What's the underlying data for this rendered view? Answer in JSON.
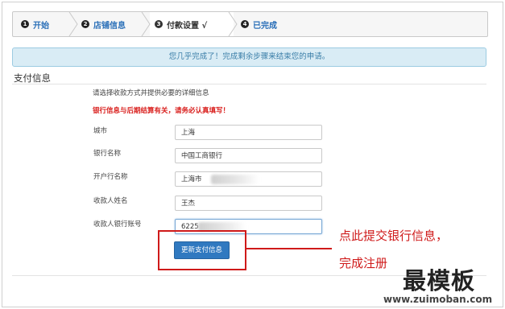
{
  "steps": [
    {
      "num": "1",
      "label": "开始"
    },
    {
      "num": "2",
      "label": "店铺信息"
    },
    {
      "num": "3",
      "label": "付款设置 √"
    },
    {
      "num": "4",
      "label": "已完成"
    }
  ],
  "alert": "您几乎完成了！完成剩余步骤来结束您的申请。",
  "section_title": "支付信息",
  "intro": "请选择收款方式并提供必要的详细信息",
  "warning": "银行信息与后期结算有关，请务必认真填写！",
  "fields": [
    {
      "label": "城市",
      "value": "上海"
    },
    {
      "label": "银行名称",
      "value": "中国工商银行"
    },
    {
      "label": "开户行名称",
      "value": "上海市"
    },
    {
      "label": "收款人姓名",
      "value": "王杰"
    },
    {
      "label": "收款人银行账号",
      "value": "6225"
    }
  ],
  "submit_label": "更新支付信息",
  "annotation": {
    "line1": "点此提交银行信息，",
    "line2": "完成注册"
  },
  "watermark": {
    "title": "最模板",
    "url": "www.zuimoban.com"
  },
  "colors": {
    "accent": "#3079c0",
    "warning": "#d9201e",
    "alert_bg": "#d9ecf5"
  }
}
